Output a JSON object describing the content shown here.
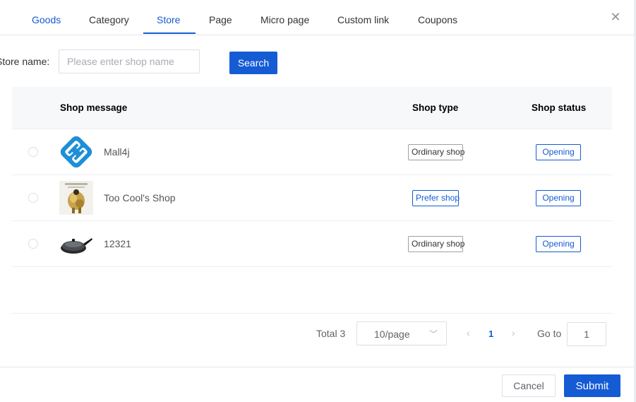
{
  "tabs": [
    {
      "label": "Goods"
    },
    {
      "label": "Category"
    },
    {
      "label": "Store"
    },
    {
      "label": "Page"
    },
    {
      "label": "Micro page"
    },
    {
      "label": "Custom link"
    },
    {
      "label": "Coupons"
    }
  ],
  "active_tab": "Store",
  "close_icon": "close-icon",
  "filter": {
    "label": "Store name:",
    "placeholder": "Please enter shop name",
    "value": "",
    "search_label": "Search"
  },
  "table": {
    "headers": {
      "message": "Shop message",
      "type": "Shop type",
      "status": "Shop status"
    },
    "rows": [
      {
        "name": "Mall4j",
        "type": "Ordinary shop",
        "status": "Opening",
        "thumb": "mall4j-logo",
        "selected": false
      },
      {
        "name": "Too Cool's Shop",
        "type": "Prefer shop",
        "status": "Opening",
        "thumb": "golden-figurine-image",
        "selected": false
      },
      {
        "name": "12321",
        "type": "Ordinary shop",
        "status": "Opening",
        "thumb": "frying-pan-image",
        "selected": false
      }
    ]
  },
  "pagination": {
    "total_label": "Total 3",
    "page_size": "10/page",
    "current_page": "1",
    "goto_label": "Go to",
    "goto_value": "1"
  },
  "footer": {
    "cancel_label": "Cancel",
    "submit_label": "Submit"
  },
  "colors": {
    "primary": "#155bd4",
    "header_bg": "#f7f8fa"
  }
}
